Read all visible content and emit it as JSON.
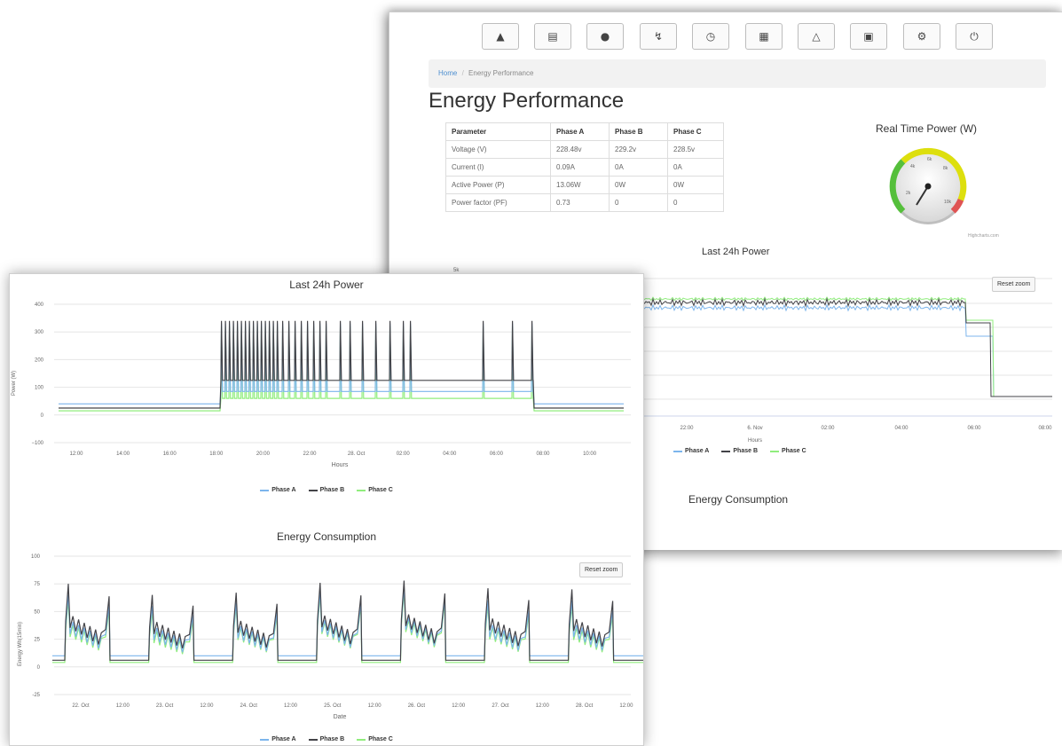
{
  "colors": {
    "phase_a": "#7cb5ec",
    "phase_b": "#434348",
    "phase_c": "#90ed7d",
    "link": "#4d8fd0"
  },
  "back_window": {
    "toolbar_icons": [
      "sitemap-icon",
      "hdd-icon",
      "users-icon",
      "bolt-icon",
      "clock-icon",
      "calendar-icon",
      "bell-icon",
      "picture-icon",
      "gear-icon",
      "power-icon"
    ],
    "breadcrumb": {
      "home": "Home",
      "separator": "/",
      "current": "Energy Performance"
    },
    "page_title": "Energy Performance",
    "table": {
      "headers": [
        "Parameter",
        "Phase A",
        "Phase B",
        "Phase C"
      ],
      "rows": [
        [
          "Voltage (V)",
          "228.48v",
          "229.2v",
          "228.5v"
        ],
        [
          "Current (I)",
          "0.09A",
          "0A",
          "0A"
        ],
        [
          "Active Power (P)",
          "13.06W",
          "0W",
          "0W"
        ],
        [
          "Power factor (PF)",
          "0.73",
          "0",
          "0"
        ]
      ]
    },
    "gauge": {
      "title": "Real Time Power (W)",
      "credit": "Highcharts.com",
      "labels": [
        "2k",
        "4k",
        "6k",
        "8k",
        "10k"
      ]
    },
    "power_chart": {
      "title": "Last 24h Power",
      "y_tick_top": "5k",
      "x_ticks": [
        "22:00",
        "6. Nov",
        "02:00",
        "04:00",
        "06:00",
        "08:00"
      ],
      "xlabel": "Hours",
      "reset_zoom": "Reset zoom"
    },
    "legend": [
      "Phase A",
      "Phase B",
      "Phase C"
    ],
    "energy_title": "Energy Consumption"
  },
  "front_window": {
    "power_chart": {
      "title": "Last 24h Power",
      "ylabel": "Power (W)",
      "xlabel": "Hours",
      "y_ticks": [
        "400",
        "300",
        "200",
        "100",
        "0",
        "−100"
      ],
      "x_ticks": [
        "12:00",
        "14:00",
        "16:00",
        "18:00",
        "20:00",
        "22:00",
        "28. Oct",
        "02:00",
        "04:00",
        "06:00",
        "08:00",
        "10:00"
      ],
      "legend": [
        "Phase A",
        "Phase B",
        "Phase C"
      ]
    },
    "energy_chart": {
      "title": "Energy Consumption",
      "ylabel": "Energy Wh(15min)",
      "xlabel": "Date",
      "y_ticks": [
        "100",
        "75",
        "50",
        "25",
        "0",
        "-25"
      ],
      "x_ticks": [
        "22. Oct",
        "12:00",
        "23. Oct",
        "12:00",
        "24. Oct",
        "12:00",
        "25. Oct",
        "12:00",
        "26. Oct",
        "12:00",
        "27. Oct",
        "12:00",
        "28. Oct",
        "12:00"
      ],
      "reset_zoom": "Reset zoom",
      "legend": [
        "Phase A",
        "Phase B",
        "Phase C"
      ]
    }
  },
  "chart_data": [
    {
      "type": "line",
      "title": "Last 24h Power",
      "xlabel": "Hours",
      "ylabel": "Power (W)",
      "ylim": [
        -100,
        400
      ],
      "x": [
        "11:00",
        "18:10",
        "18:10",
        "07:40",
        "07:40",
        "11:30"
      ],
      "series": [
        {
          "name": "Phase A",
          "values": [
            40,
            40,
            85,
            85,
            35,
            35
          ]
        },
        {
          "name": "Phase B",
          "values": [
            25,
            25,
            125,
            125,
            25,
            25
          ]
        },
        {
          "name": "Phase C",
          "values": [
            15,
            15,
            60,
            60,
            15,
            15
          ]
        }
      ],
      "notes_spikes_y": 340
    },
    {
      "type": "line",
      "title": "Energy Consumption",
      "xlabel": "Date",
      "ylabel": "Energy Wh(15min)",
      "ylim": [
        -25,
        100
      ],
      "categories": [
        "22. Oct",
        "23. Oct",
        "24. Oct",
        "25. Oct",
        "26. Oct",
        "27. Oct",
        "28. Oct"
      ],
      "series": [
        {
          "name": "Phase A",
          "values": [
            65,
            55,
            58,
            68,
            72,
            60,
            60
          ]
        },
        {
          "name": "Phase B",
          "values": [
            75,
            65,
            67,
            76,
            78,
            71,
            70
          ]
        },
        {
          "name": "Phase C",
          "values": [
            60,
            50,
            55,
            65,
            68,
            56,
            55
          ]
        }
      ]
    }
  ]
}
